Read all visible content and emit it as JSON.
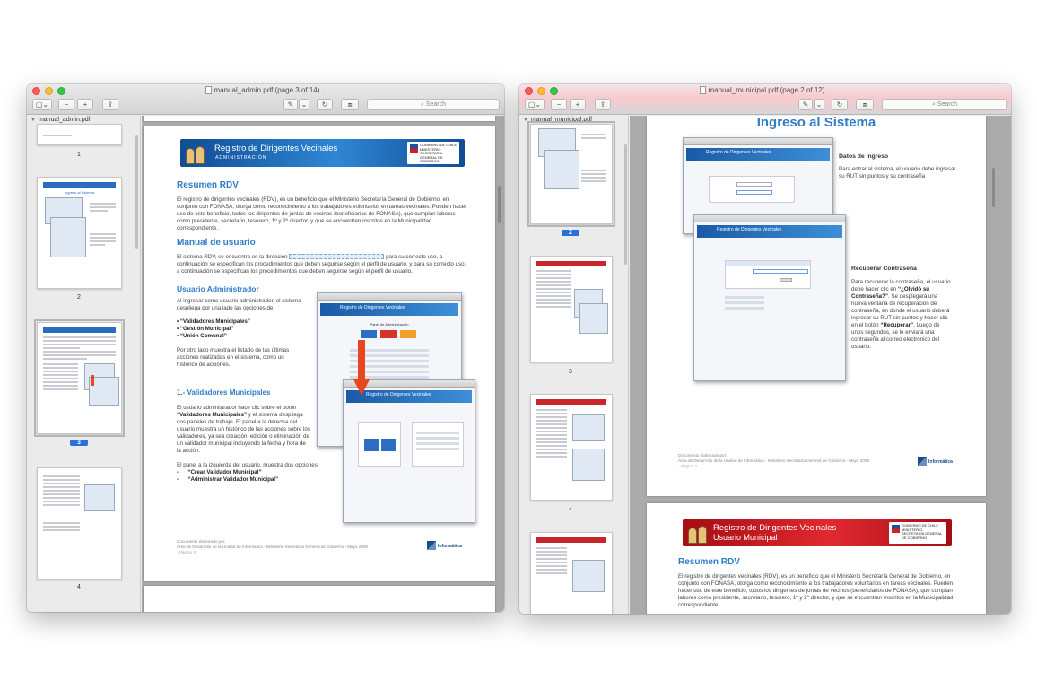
{
  "left_window": {
    "title": "manual_admin.pdf (page 3 of 14)",
    "toolbar": {
      "sidebar_btn": "▢⌄",
      "zoom_out": "−",
      "zoom_in": "+",
      "share": "⇪",
      "markup": "✎",
      "markup_menu": "⌄",
      "rotate": "↻",
      "toolbox": "⧈",
      "search_placeholder": "Search"
    },
    "sidebar": {
      "file": "manual_admin.pdf",
      "thumb_labels": [
        "1",
        "2",
        "3",
        "4"
      ],
      "selected": "3",
      "thumb2_title": "Ingreso al Sistema"
    },
    "page": {
      "banner_title": "Registro de Dirigentes Vecinales",
      "banner_subtitle": "ADMINISTRACIÓN",
      "banner_logo": "GOBIERNO DE CHILE MINISTERIO SECRETARÍA GENERAL DE GOBIERNO",
      "h1": "Resumen RDV",
      "p1": "El registro de dirigentes vecinales (RDV), es un beneficio que el Ministerio Secretaría General de Gobierno, en conjunto con  FONASA, otorga como reconocimiento a los trabajadores voluntarios en tareas vecinales. Pueden hacer uso de este beneficio, todos los dirigentes de juntas de vecinos (beneficiarios de FONASA), que cumplan labores como presidente, secretario, tesorero, 1º y 2º director, y que se encuentren inscritos en la Municipalidad correspondiente.",
      "h2": "Manual de usuario",
      "p2a": "El sistema RDV, se encuentra en la dirección",
      "p2b": "para su correcto uso, a continuación se especifican los procedimientos que deben seguirse según el perfil de usuario. y para su correcto uso, a continuación se especifican los procedimientos que deben seguirse según el perfil de usuario.",
      "h3": "Usuario Administrador",
      "p3": "Al ingresar como usuario administrador, el sistema despliega por una lado las opciones de:",
      "opt1": "• “Validadores Municipales”",
      "opt2": "• “Gestión Municipal”",
      "opt3": "• “Unión Comunal”",
      "p4": "Por otro lado muestra el listado de las últimas acciones realizadas en el sistema, como un histórico de acciones.",
      "h4": "1.- Validadores Municipales",
      "p5a": "El usuario administrador hace clic sobre el botón",
      "p5b": "“Validadores Municipales”",
      "p5c": "y el sistema despliega dos paneles de trabajo. El panel a la derecha del usuario muestra un histórico de las acciones sobre los validadores, ya sea creación, edición o eliminación de un validador municipal incluyendo la fecha y hora de la acción.",
      "p6": "El panel a la izquierda del usuario, muestra dos opciones:",
      "p6o1": "“Crear Validador Municipal”",
      "p6o2": "“Administrar Validador Municipal”",
      "footer1": "Documento elaborado por:",
      "footer2": "Área de Desarrollo de la Unidad de Informática - Ministerio Secretaría General de Gobierno - Mayo 2009",
      "footer3": "- Página 3",
      "logo": "Informática",
      "shot_banner": "Registro de Dirigentes Vecinales",
      "shot_panel": "Panel de Administración"
    }
  },
  "right_window": {
    "title": "manual_municipal.pdf (page 2 of 12)",
    "toolbar": {
      "sidebar_btn": "▢⌄",
      "zoom_out": "−",
      "zoom_in": "+",
      "share": "⇪",
      "markup": "✎",
      "markup_menu": "⌄",
      "rotate": "↻",
      "toolbox": "⧈",
      "search_placeholder": "Search"
    },
    "sidebar": {
      "file": "manual_municipal.pdf",
      "thumb_labels": [
        "2",
        "3",
        "4"
      ],
      "selected": "2"
    },
    "page2": {
      "heading": "Ingreso al Sistema",
      "s1_title": "Datos de Ingreso",
      "s1_text": "Para entrar al sistema, el usuario debe ingresar su RUT sin puntos y su contraseña",
      "s2_title": "Recuperar Contraseña",
      "s2_text_a": "Para recuperar la contraseña, el usuario debe hacer clic en",
      "s2_text_b": "“¿Olvidó su Contraseña?”",
      "s2_text_c": ". Se desplegará una nueva ventana de recuperación de contraseña, en donde el usuario deberá ingresar su RUT sin puntos y hacer clic en el botón",
      "s2_text_d": "“Recuperar”",
      "s2_text_e": ". Luego de unos segundos, se le enviará una contraseña al correo electrónico del usuario.",
      "footer1": "Documento elaborado por:",
      "footer2": "Área de Desarrollo de la Unidad de Informática - Ministerio Secretaría General de Gobierno - Mayo 2009",
      "footer3": "- Página 2",
      "logo": "Informática",
      "shot_banner": "Registro de Dirigentes Vecinales"
    },
    "page3": {
      "banner_title": "Registro de Dirigentes Vecinales",
      "banner_subtitle": "Usuario Municipal",
      "banner_logo": "GOBIERNO DE CHILE MINISTERIO SECRETARÍA GENERAL DE GOBIERNO",
      "h1": "Resumen RDV",
      "p1": "El registro de dirigentes vecinales (RDV), es un beneficio que el Ministerio Secretaría General de Gobierno, en conjunto con  FONASA, otorga como reconocimiento a los trabajadores voluntarios en tareas vecinales. Pueden hacer uso de este beneficio, todos los dirigentes de juntas de vecinos (beneficiarios de FONASA), que cumplan labores como presidente, secretario, tesorero, 1º y 2º director, y que se encuentren inscritos en la Municipalidad correspondiente."
    }
  },
  "colors": {
    "accent_blue": "#2f7cc7",
    "banner_blue": "#1a5aa6",
    "banner_red": "#d0232a",
    "selection": "#2a6fd6"
  }
}
